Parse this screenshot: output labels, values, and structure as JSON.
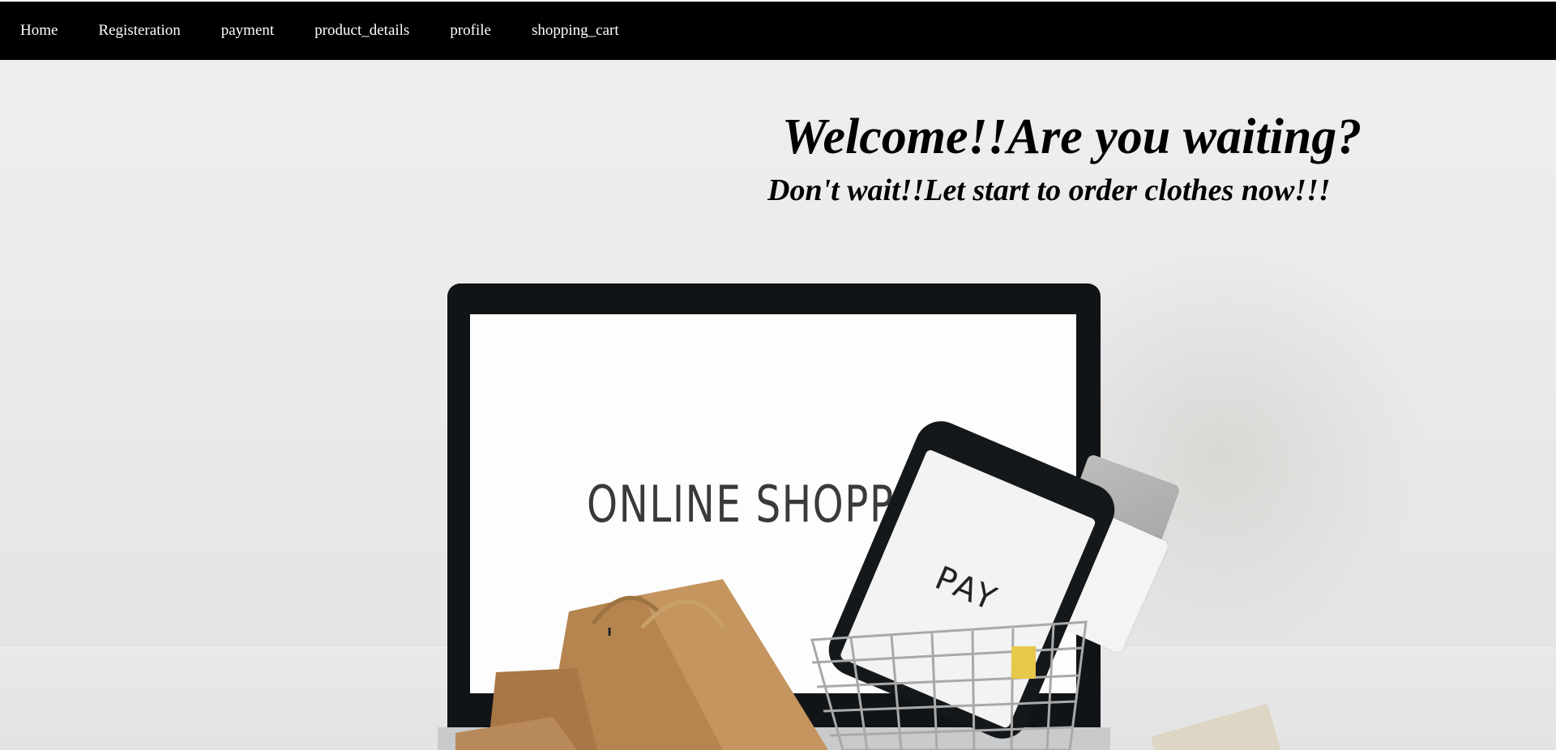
{
  "nav": {
    "links": [
      "Home",
      "Registeration",
      "payment",
      "product_details",
      "profile",
      "shopping_cart"
    ]
  },
  "hero": {
    "title": "Welcome!!Are you waiting?",
    "subtitle": "Don't wait!!Let start to order clothes now!!!",
    "image": {
      "laptop_screen_text": "ONLINE SHOPPING",
      "phone_screen_text": "PAY"
    }
  },
  "colors": {
    "navbar_background": "#000000",
    "nav_text": "#ffffff",
    "heading_text": "#000000"
  },
  "icons": {
    "laptop": "laptop-illustration",
    "phone": "smartphone-illustration",
    "cart": "shopping-cart-illustration",
    "bags": "paper-shopping-bags-illustration"
  }
}
